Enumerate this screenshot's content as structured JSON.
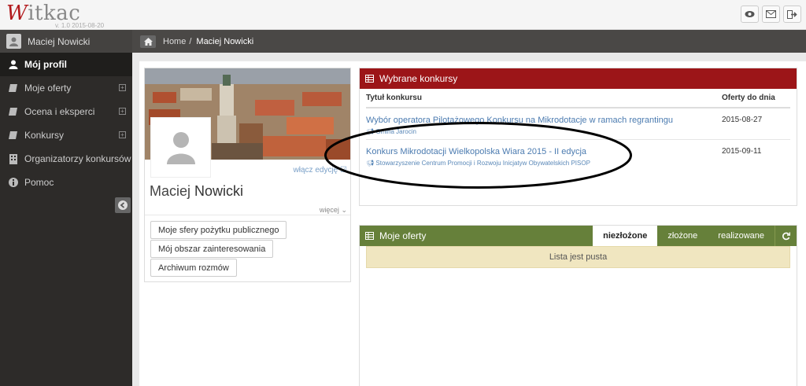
{
  "app": {
    "logo_w": "W",
    "logo_rest": "itkac",
    "version": "v. 1.0 2015-08-20"
  },
  "top_icons": [
    "eye-icon",
    "envelope-icon",
    "sign-out-icon"
  ],
  "sidebar": {
    "user_name": "Maciej Nowicki",
    "items": [
      {
        "label": "Mój profil",
        "icon": "user-icon",
        "active": true
      },
      {
        "label": "Moje oferty",
        "icon": "book-icon",
        "expandable": true
      },
      {
        "label": "Ocena i eksperci",
        "icon": "book-icon",
        "expandable": true
      },
      {
        "label": "Konkursy",
        "icon": "book-icon",
        "expandable": true
      },
      {
        "label": "Organizatorzy konkursów",
        "icon": "building-icon"
      },
      {
        "label": "Pomoc",
        "icon": "info-icon"
      }
    ]
  },
  "breadcrumb": {
    "home": "Home",
    "separator": "/",
    "current": "Maciej Nowicki"
  },
  "profile": {
    "first_name": "Maciej",
    "last_name": "Nowicki",
    "edit_link": "włącz edycję",
    "more_link": "więcej",
    "buttons": [
      "Moje sfery pożytku publicznego",
      "Mój obszar zainteresowania",
      "Archiwum rozmów"
    ]
  },
  "selected_contests": {
    "title": "Wybrane konkursy",
    "col_title": "Tytuł konkursu",
    "col_date": "Oferty do dnia",
    "rows": [
      {
        "title": "Wybór operatora Pilotażowego Konkursu na Mikrodotacje w ramach regrantingu",
        "org": "Gmina Jarocin",
        "date": "2015-08-27"
      },
      {
        "title": "Konkurs Mikrodotacji Wielkopolska Wiara 2015 - II edycja",
        "org": "Stowarzyszenie Centrum Promocji i Rozwoju Inicjatyw Obywatelskich PISOP",
        "date": "2015-09-11"
      }
    ]
  },
  "my_offers": {
    "title": "Moje oferty",
    "tabs": [
      "niezłożone",
      "złożone",
      "realizowane"
    ],
    "active_tab": "niezłożone",
    "empty_text": "Lista jest pusta"
  },
  "colors": {
    "contests_header": "#9c1518",
    "offers_header": "#66803a",
    "sidebar_bg": "#2d2b29"
  }
}
